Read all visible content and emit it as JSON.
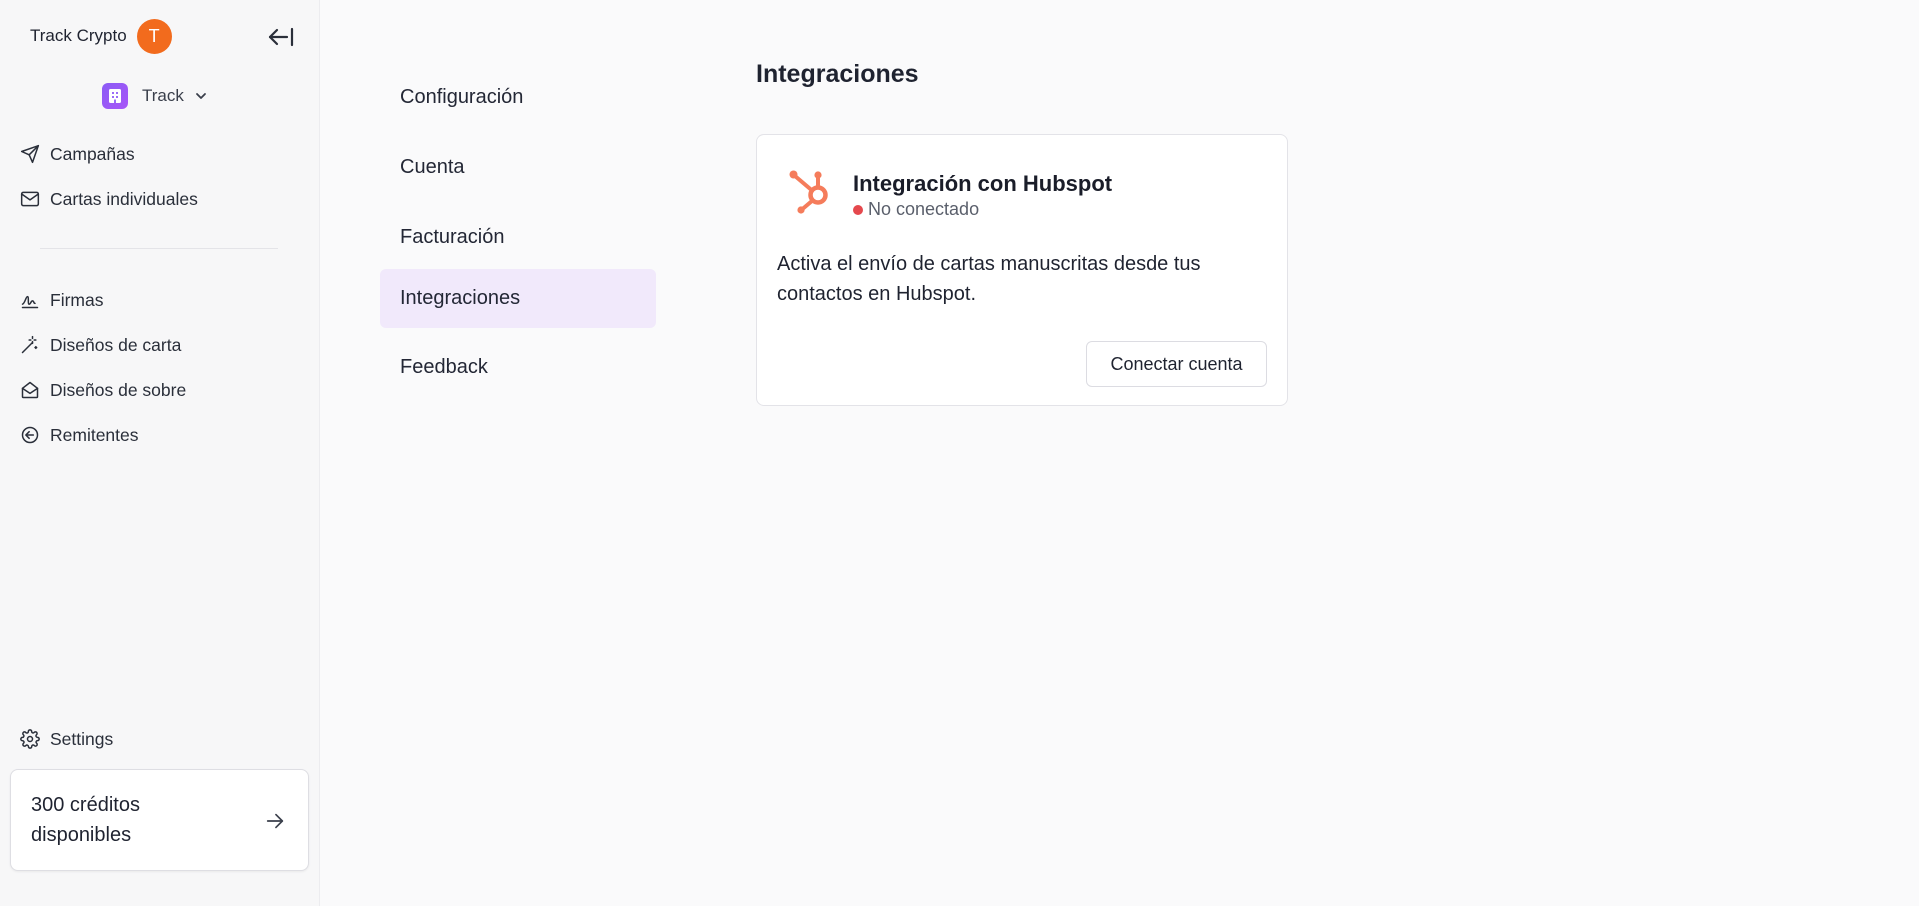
{
  "sidebar": {
    "account_name": "Track Crypto",
    "avatar_initial": "T",
    "workspace": "Track",
    "items": [
      {
        "label": "Campañas",
        "icon": "send-icon"
      },
      {
        "label": "Cartas individuales",
        "icon": "mail-icon"
      },
      {
        "label": "Firmas",
        "icon": "signature-icon"
      },
      {
        "label": "Diseños de carta",
        "icon": "magic-wand-icon"
      },
      {
        "label": "Diseños de sobre",
        "icon": "envelope-open-icon"
      },
      {
        "label": "Remitentes",
        "icon": "arrow-circle-left-icon"
      }
    ],
    "settings_label": "Settings",
    "credits_text": "300 créditos disponibles"
  },
  "settings_nav": {
    "items": [
      {
        "label": "Configuración",
        "active": false
      },
      {
        "label": "Cuenta",
        "active": false
      },
      {
        "label": "Facturación",
        "active": false
      },
      {
        "label": "Integraciones",
        "active": true
      },
      {
        "label": "Feedback",
        "active": false
      }
    ]
  },
  "main": {
    "title": "Integraciones",
    "card": {
      "title": "Integración con Hubspot",
      "status": "No conectado",
      "description": "Activa el envío de cartas manuscritas desde tus contactos en Hubspot.",
      "button_label": "Conectar cuenta"
    }
  },
  "colors": {
    "accent": "#8b5cf6",
    "active_bg": "#f1e9fb",
    "avatar": "#f26b1d",
    "hubspot": "#f57c5b",
    "status_error": "#e5484d"
  }
}
